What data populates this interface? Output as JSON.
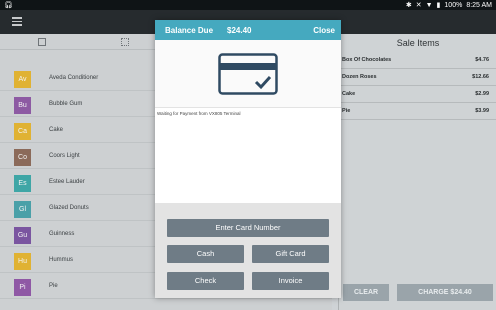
{
  "status_bar": {
    "time": "8:25 AM",
    "battery": "100%"
  },
  "products": [
    {
      "abbr": "Av",
      "name": "Aveda Conditioner",
      "color": "#e0b233"
    },
    {
      "abbr": "Bu",
      "name": "Bubble Gum",
      "color": "#8d5aa3"
    },
    {
      "abbr": "Ca",
      "name": "Cake",
      "color": "#e0b233"
    },
    {
      "abbr": "Co",
      "name": "Coors Light",
      "color": "#8b6a5a"
    },
    {
      "abbr": "Es",
      "name": "Estee Lauder",
      "color": "#3fa6a6"
    },
    {
      "abbr": "Gl",
      "name": "Glazed Donuts",
      "color": "#4aa0a8"
    },
    {
      "abbr": "Gu",
      "name": "Guinness",
      "color": "#7a55a0"
    },
    {
      "abbr": "Hu",
      "name": "Hummus",
      "color": "#e0b233"
    },
    {
      "abbr": "Pi",
      "name": "Pie",
      "color": "#8f58a5"
    }
  ],
  "sale": {
    "title": "Sale Items",
    "items": [
      {
        "name": "Box Of Chocolates",
        "price": "$4.76"
      },
      {
        "name": "Dozen Roses",
        "price": "$12.66"
      },
      {
        "name": "Cake",
        "price": "$2.99"
      },
      {
        "name": "Pie",
        "price": "$3.99"
      }
    ],
    "clear_label": "CLEAR",
    "charge_label": "CHARGE $24.40"
  },
  "dialog": {
    "title": "Balance Due",
    "amount": "$24.40",
    "close_label": "Close",
    "status_text": "Waiting for Payment from VX805 Terminal",
    "buttons": {
      "enter_card": "Enter Card Number",
      "cash": "Cash",
      "gift_card": "Gift Card",
      "check": "Check",
      "invoice": "Invoice"
    },
    "accent_color": "#45a9bf"
  }
}
